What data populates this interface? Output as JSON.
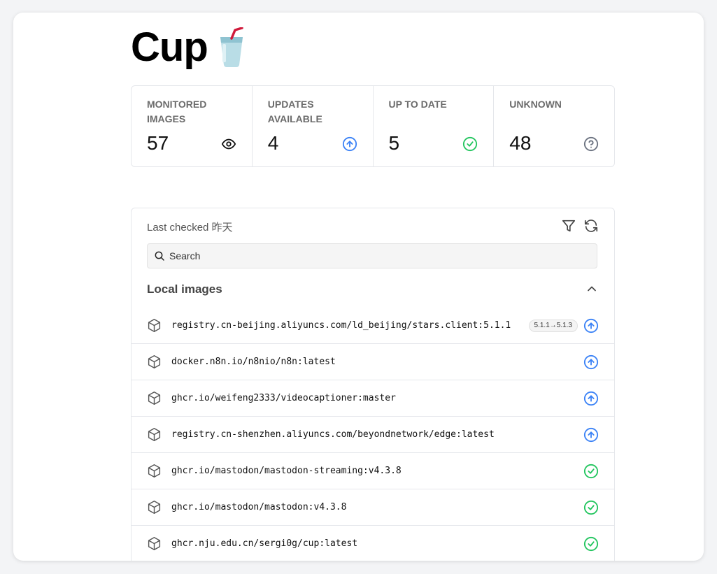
{
  "app": {
    "title": "Cup"
  },
  "stats": [
    {
      "label": "Monitored images",
      "value": "57",
      "icon": "eye-icon"
    },
    {
      "label": "Updates available",
      "value": "4",
      "icon": "arrow-up-circle-icon",
      "color": "#3b82f6"
    },
    {
      "label": "Up to date",
      "value": "5",
      "icon": "check-circle-icon",
      "color": "#22c55e"
    },
    {
      "label": "Unknown",
      "value": "48",
      "icon": "help-circle-icon",
      "color": "#6b7280"
    }
  ],
  "panel": {
    "last_checked": "Last checked 昨天",
    "search_placeholder": "Search",
    "section_title": "Local images"
  },
  "images": [
    {
      "name": "registry.cn-beijing.aliyuncs.com/ld_beijing/stars.client:5.1.1",
      "badge": "5.1.1→5.1.3",
      "status": "update"
    },
    {
      "name": "docker.n8n.io/n8nio/n8n:latest",
      "status": "update"
    },
    {
      "name": "ghcr.io/weifeng2333/videocaptioner:master",
      "status": "update"
    },
    {
      "name": "registry.cn-shenzhen.aliyuncs.com/beyondnetwork/edge:latest",
      "status": "update"
    },
    {
      "name": "ghcr.io/mastodon/mastodon-streaming:v4.3.8",
      "status": "ok"
    },
    {
      "name": "ghcr.io/mastodon/mastodon:v4.3.8",
      "status": "ok"
    },
    {
      "name": "ghcr.nju.edu.cn/sergi0g/cup:latest",
      "status": "ok"
    }
  ],
  "colors": {
    "update": "#3b82f6",
    "ok": "#22c55e",
    "unknown": "#6b7280"
  }
}
